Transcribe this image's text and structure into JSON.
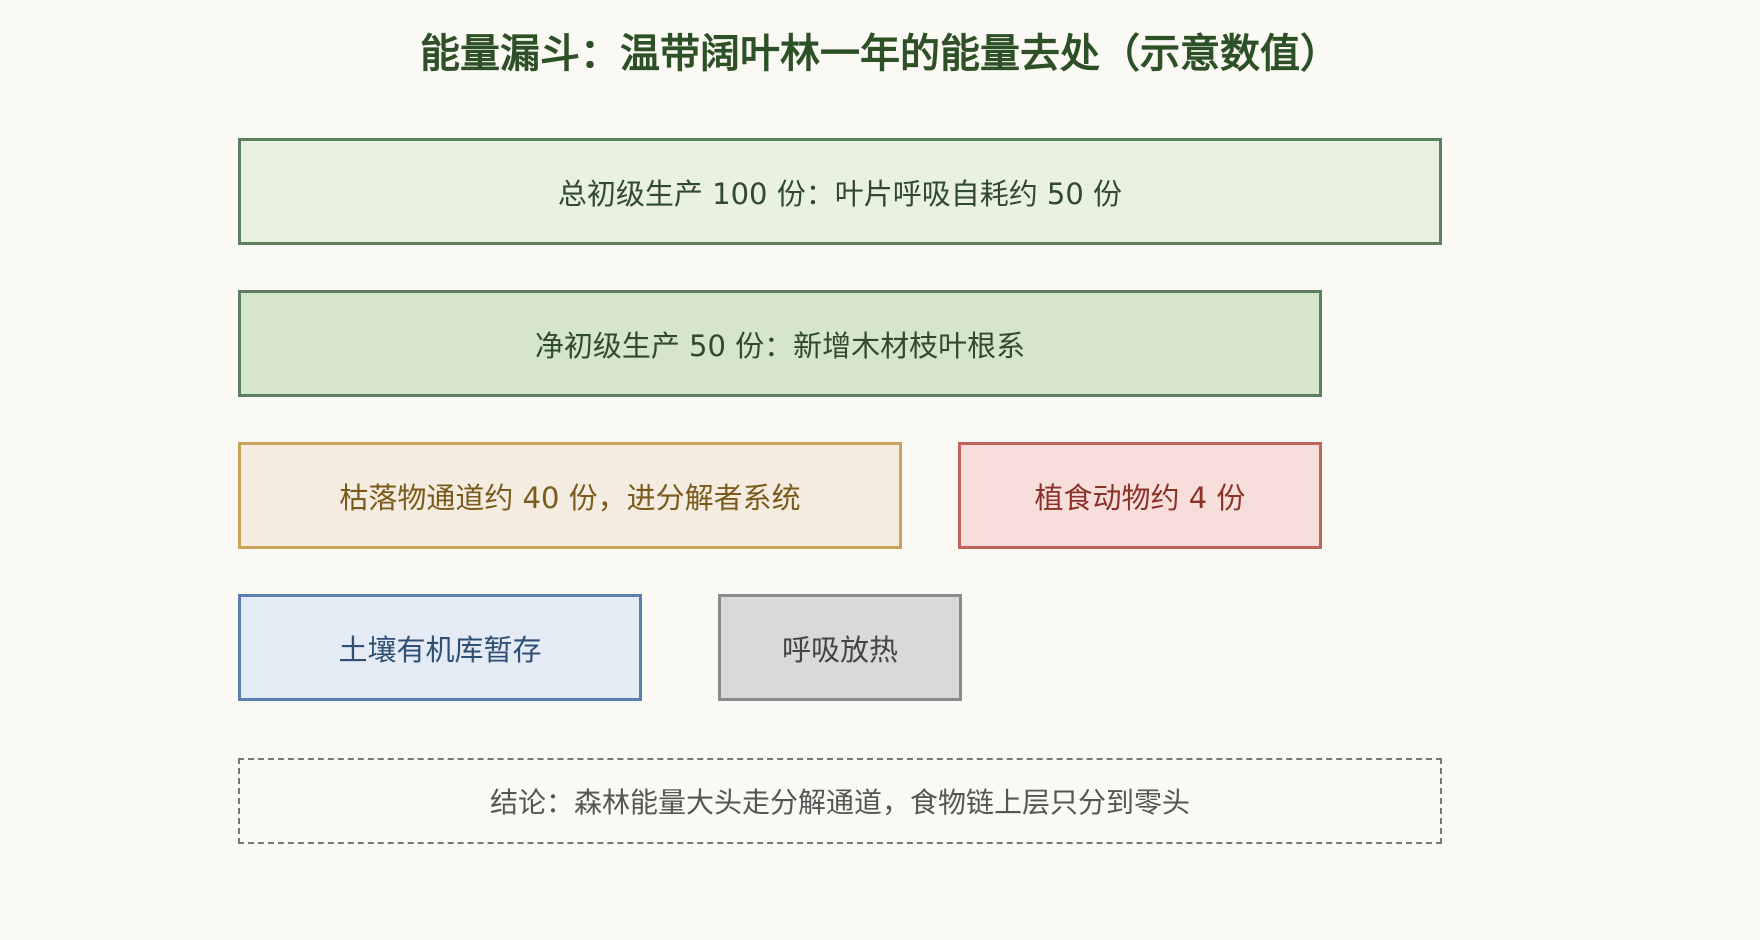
{
  "title": "能量漏斗：温带阔叶林一年的能量去处（示意数值）",
  "nodes": {
    "gpp": "总初级生产 100 份：叶片呼吸自耗约 50 份",
    "npp": "净初级生产 50 份：新增木材枝叶根系",
    "litter": "枯落物通道约 40 份，进分解者系统",
    "herbivores": "植食动物约 4 份",
    "soil": "土壤有机库暂存",
    "respiration": "呼吸放热"
  },
  "conclusion": "结论：森林能量大头走分解通道，食物链上层只分到零头",
  "colors": {
    "title": "#2e5027",
    "production_border": "#5c8060",
    "litter_border": "#c9a35a",
    "herbivore_border": "#c0635b",
    "soil_border": "#5b7fae",
    "respiration_border": "#8b8b8b"
  }
}
